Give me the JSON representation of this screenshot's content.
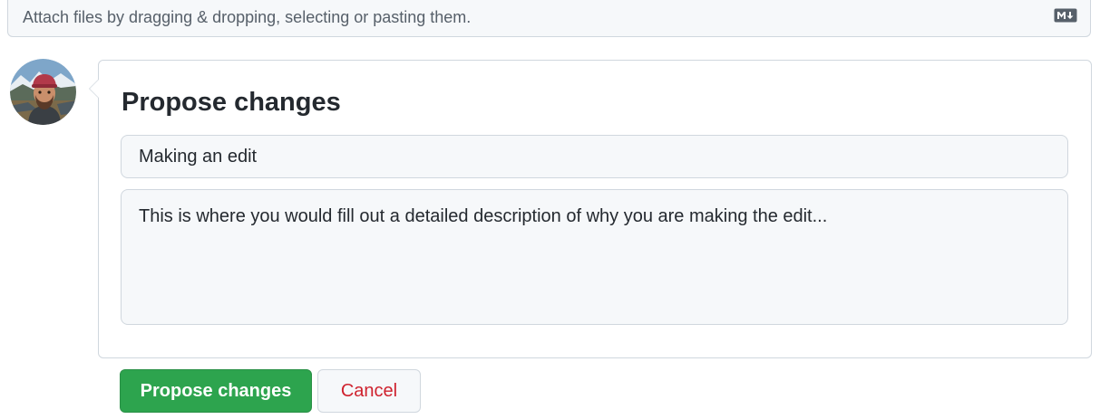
{
  "attach": {
    "text": "Attach files by dragging & dropping, selecting or pasting them.",
    "markdown_icon": "markdown-icon"
  },
  "avatar": {
    "icon": "user-avatar"
  },
  "propose": {
    "heading": "Propose changes",
    "title_value": "Making an edit",
    "description_value": "This is where you would fill out a detailed description of why you are making the edit..."
  },
  "actions": {
    "submit_label": "Propose changes",
    "cancel_label": "Cancel"
  },
  "colors": {
    "primary": "#2da44e",
    "danger": "#cf222e",
    "border": "#d0d7de",
    "input_bg": "#f6f8fa"
  }
}
